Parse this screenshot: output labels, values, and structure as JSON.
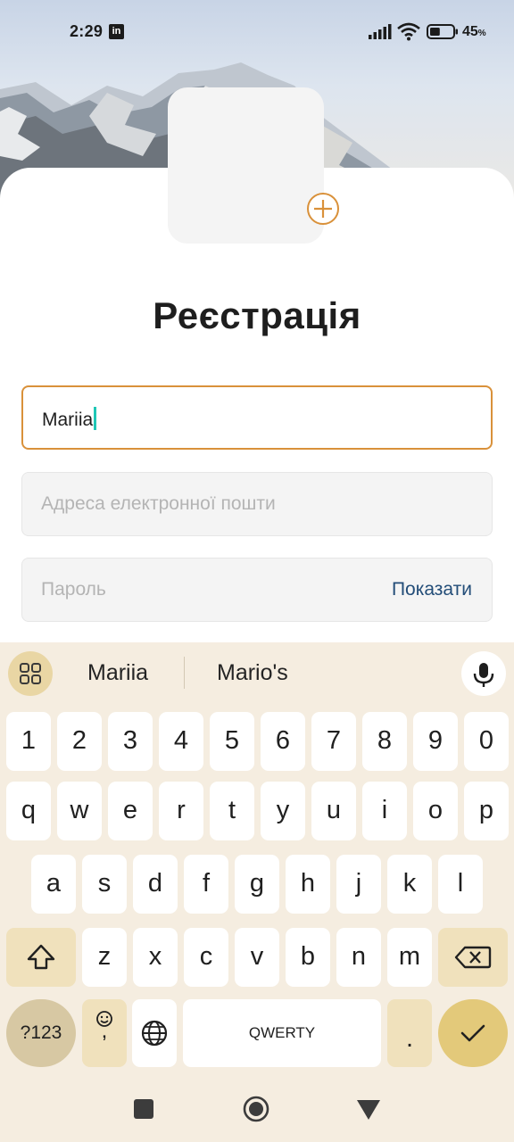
{
  "status_bar": {
    "time": "2:29",
    "linkedin_badge": "in",
    "battery_percent": "45",
    "battery_unit": "%",
    "battery_level": 0.45
  },
  "form": {
    "title": "Реєстрація",
    "name_value": "Mariia",
    "email_placeholder": "Адреса електронної пошти",
    "password_placeholder": "Пароль",
    "show_password_label": "Показати",
    "accent_color": "#d9913a",
    "link_color": "#234d78"
  },
  "keyboard": {
    "suggestions": [
      "Mariia",
      "Mario's"
    ],
    "number_row": [
      "1",
      "2",
      "3",
      "4",
      "5",
      "6",
      "7",
      "8",
      "9",
      "0"
    ],
    "row1": [
      "q",
      "w",
      "e",
      "r",
      "t",
      "y",
      "u",
      "i",
      "o",
      "p"
    ],
    "row2": [
      "a",
      "s",
      "d",
      "f",
      "g",
      "h",
      "j",
      "k",
      "l"
    ],
    "row3": [
      "z",
      "x",
      "c",
      "v",
      "b",
      "n",
      "m"
    ],
    "symbols_label": "?123",
    "emoji_comma_label": ",",
    "space_label": "QWERTY",
    "period_label": ".",
    "icons": {
      "apps": "grid-icon",
      "mic": "microphone-icon",
      "shift": "shift-icon",
      "backspace": "backspace-icon",
      "emoji": "emoji-icon",
      "language": "globe-icon",
      "enter": "checkmark-icon"
    }
  },
  "navigation": {
    "icons": [
      "recents-square-icon",
      "home-circle-icon",
      "back-triangle-icon"
    ]
  }
}
